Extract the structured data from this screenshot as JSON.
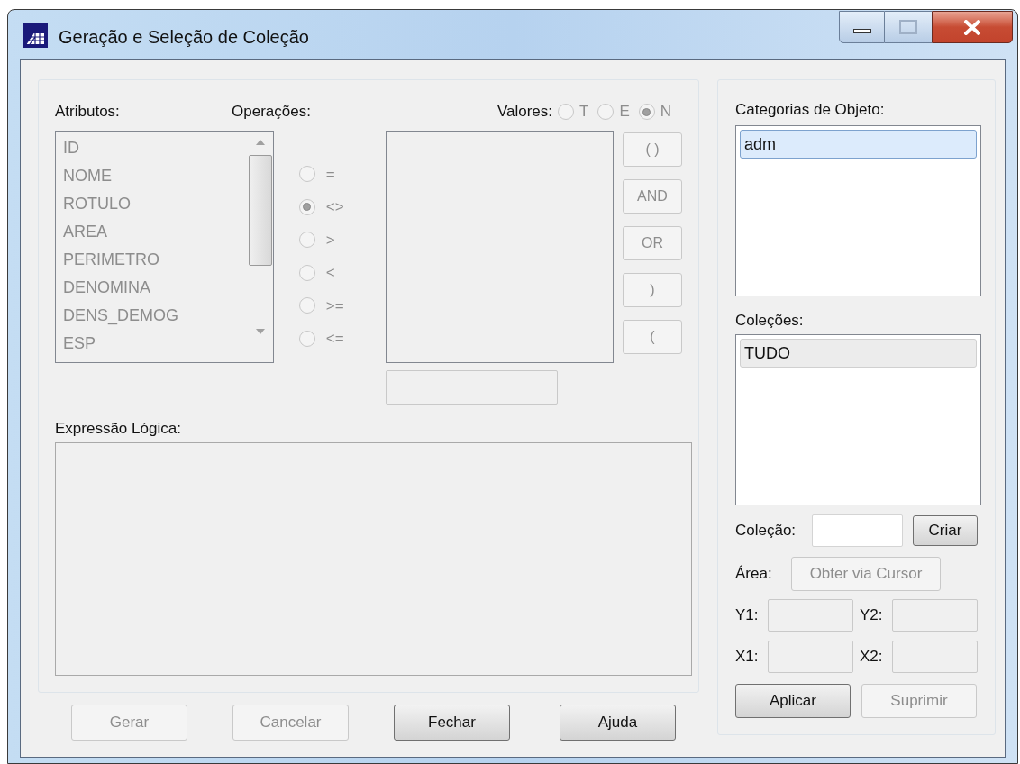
{
  "window": {
    "title": "Geração e Seleção de Coleção"
  },
  "attributes": {
    "label": "Atributos:",
    "disabled": true,
    "items": [
      "ID",
      "NOME",
      "ROTULO",
      "AREA",
      "PERIMETRO",
      "DENOMINA",
      "DENS_DEMOG",
      "ESP"
    ]
  },
  "operations": {
    "label": "Operações:",
    "disabled": true,
    "items": [
      {
        "label": "=",
        "selected": false
      },
      {
        "label": "<>",
        "selected": true
      },
      {
        "label": ">",
        "selected": false
      },
      {
        "label": "<",
        "selected": false
      },
      {
        "label": ">=",
        "selected": false
      },
      {
        "label": "<=",
        "selected": false
      }
    ]
  },
  "values": {
    "label": "Valores:",
    "disabled": true,
    "options": [
      {
        "label": "T",
        "selected": false
      },
      {
        "label": "E",
        "selected": false
      },
      {
        "label": "N",
        "selected": true
      }
    ]
  },
  "operator_buttons": {
    "disabled": true,
    "items": [
      "( )",
      "AND",
      "OR",
      ")",
      "("
    ]
  },
  "logical_expression": {
    "label": "Expressão Lógica:"
  },
  "buttons": [
    {
      "label": "Gerar",
      "disabled": true
    },
    {
      "label": "Cancelar",
      "disabled": true
    },
    {
      "label": "Fechar",
      "disabled": false
    },
    {
      "label": "Ajuda",
      "disabled": false
    }
  ],
  "categories": {
    "label": "Categorias de Objeto:",
    "focused": true,
    "items": [
      {
        "label": "adm",
        "selected": true
      }
    ]
  },
  "collections": {
    "label": "Coleções:",
    "focused": false,
    "items": [
      {
        "label": "TUDO",
        "selected": true
      }
    ]
  },
  "collection": {
    "label": "Coleção:",
    "button": "Criar"
  },
  "area": {
    "label": "Área:",
    "button": "Obter via Cursor",
    "disabled": true
  },
  "coordinates": [
    {
      "label": "Y1:"
    },
    {
      "label": "Y2:"
    },
    {
      "label": "X1:"
    },
    {
      "label": "X2:"
    }
  ],
  "actions": [
    {
      "label": "Aplicar",
      "disabled": false
    },
    {
      "label": "Suprimir",
      "disabled": true
    }
  ]
}
